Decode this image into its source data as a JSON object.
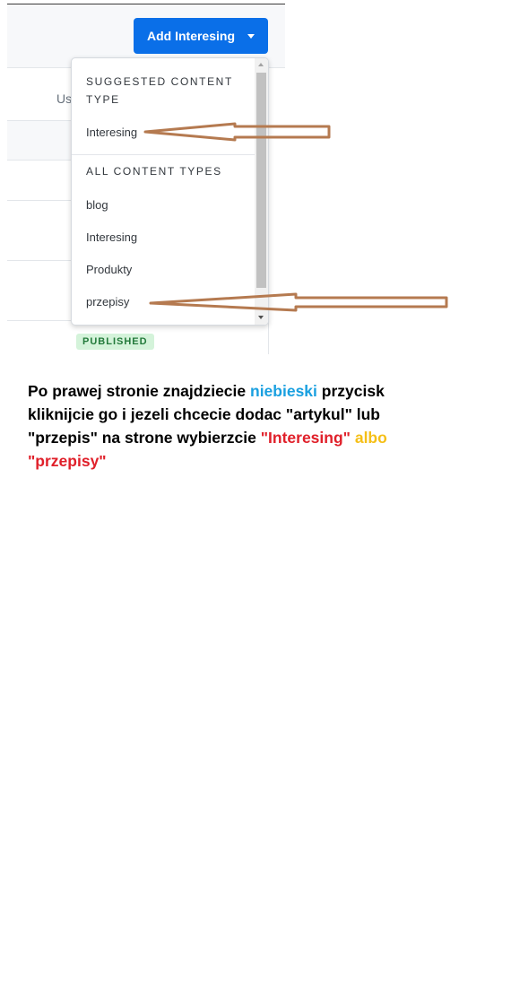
{
  "header": {
    "add_button_label": "Add Interesing"
  },
  "table": {
    "column_label_partial": "Us",
    "status_badge": "PUBLISHED"
  },
  "dropdown": {
    "suggested_heading": "SUGGESTED CONTENT TYPE",
    "suggested_items": [
      "Interesing"
    ],
    "all_heading": "ALL CONTENT TYPES",
    "all_items": [
      "blog",
      "Interesing",
      "Produkty",
      "przepisy"
    ]
  },
  "annotation": {
    "arrow_color": "#b57a50",
    "segments": [
      {
        "text": "Po prawej stronie znajdziecie ",
        "color": "#000000"
      },
      {
        "text": "niebieski",
        "color": "#1aa0e0"
      },
      {
        "text": " przycisk kliknijcie go i jezeli chcecie dodac \"artykul\" lub \"przepis\" na strone wybierzcie  ",
        "color": "#000000"
      },
      {
        "text": "\"Interesing\"",
        "color": "#e0202a"
      },
      {
        "text": " albo",
        "color": "#f5bf17"
      },
      {
        "text": " \"przepisy\"",
        "color": "#e0202a"
      }
    ]
  },
  "colors": {
    "primary_button": "#0a6fe8",
    "badge_bg": "#d4f3da",
    "badge_text": "#237a3b"
  }
}
